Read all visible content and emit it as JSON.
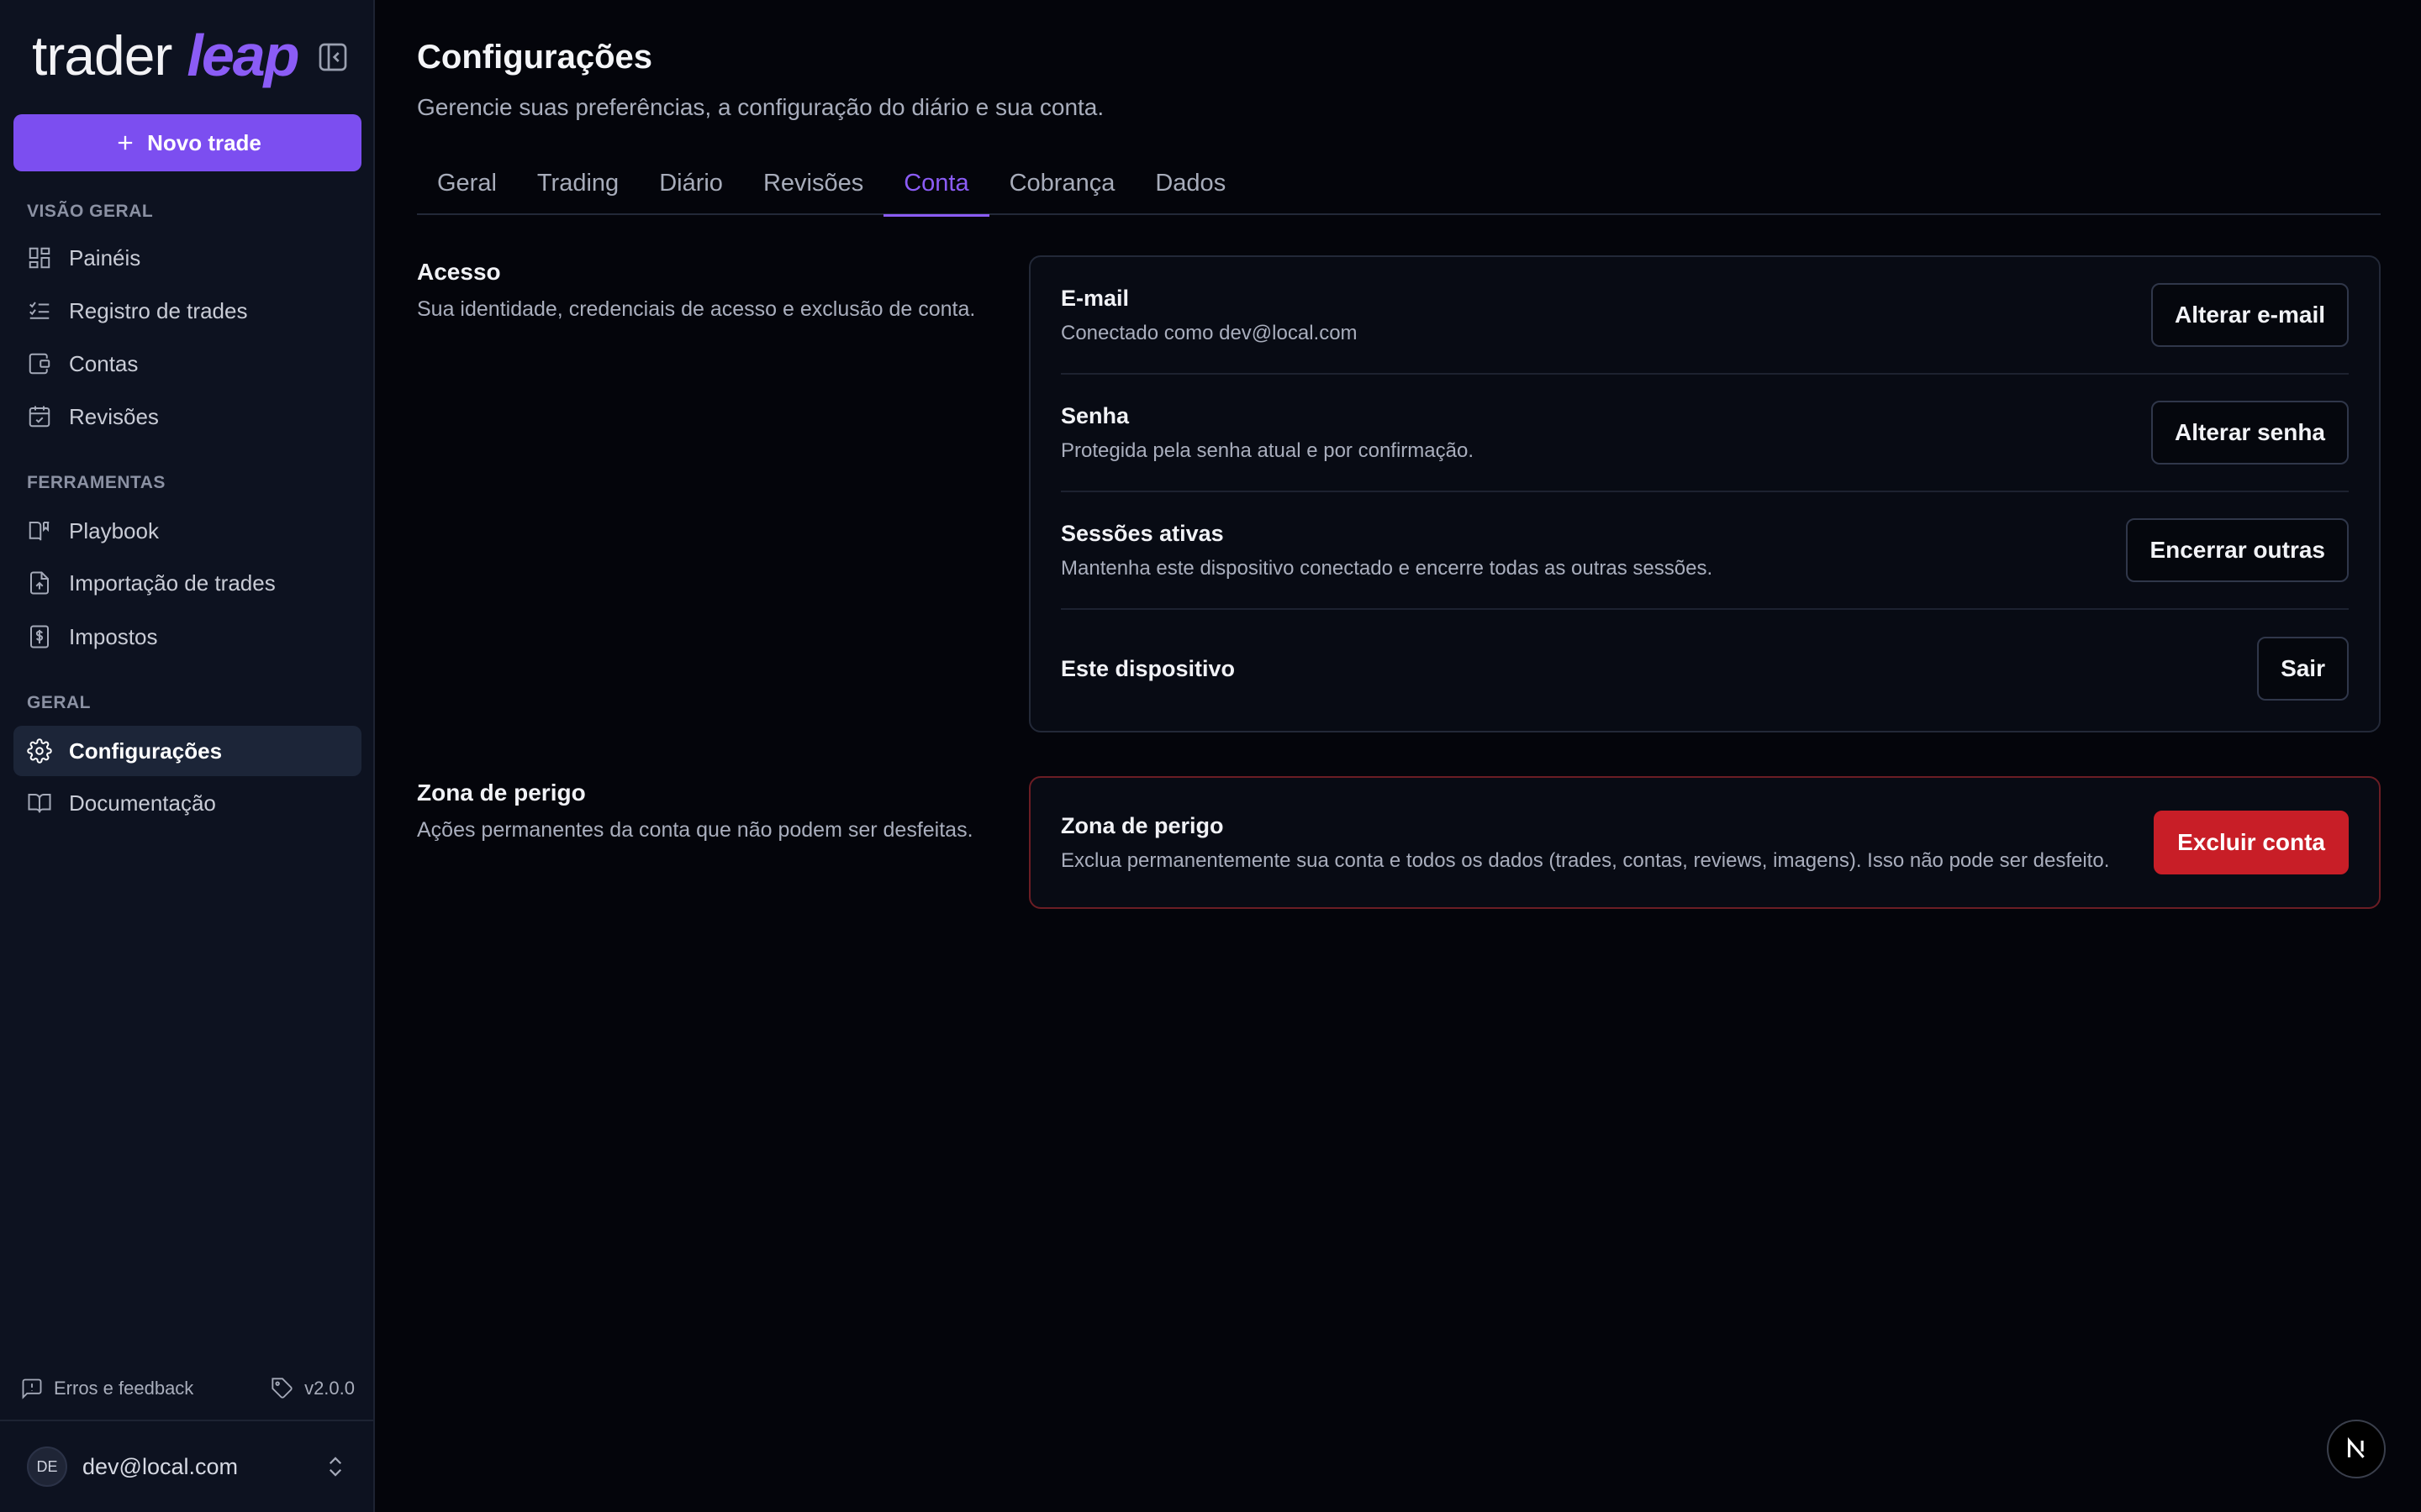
{
  "brand": {
    "part1": "trader",
    "part2": "leap"
  },
  "sidebar": {
    "new_trade_label": "Novo trade",
    "sections": [
      {
        "label": "VISÃO GERAL",
        "items": [
          {
            "label": "Painéis",
            "icon": "dashboard-icon"
          },
          {
            "label": "Registro de trades",
            "icon": "list-check-icon"
          },
          {
            "label": "Contas",
            "icon": "wallet-icon"
          },
          {
            "label": "Revisões",
            "icon": "calendar-check-icon"
          }
        ]
      },
      {
        "label": "FERRAMENTAS",
        "items": [
          {
            "label": "Playbook",
            "icon": "book-icon"
          },
          {
            "label": "Importação de trades",
            "icon": "file-upload-icon"
          },
          {
            "label": "Impostos",
            "icon": "tax-icon"
          }
        ]
      },
      {
        "label": "GERAL",
        "items": [
          {
            "label": "Configurações",
            "icon": "gear-icon",
            "active": true
          },
          {
            "label": "Documentação",
            "icon": "open-book-icon"
          }
        ]
      }
    ],
    "footer": {
      "feedback_label": "Erros e feedback",
      "version": "v2.0.0"
    },
    "user": {
      "initials": "DE",
      "email": "dev@local.com"
    }
  },
  "header": {
    "title": "Configurações",
    "subtitle": "Gerencie suas preferências, a configuração do diário e sua conta."
  },
  "tabs": [
    {
      "label": "Geral"
    },
    {
      "label": "Trading"
    },
    {
      "label": "Diário"
    },
    {
      "label": "Revisões"
    },
    {
      "label": "Conta",
      "active": true
    },
    {
      "label": "Cobrança"
    },
    {
      "label": "Dados"
    }
  ],
  "access": {
    "title": "Acesso",
    "description": "Sua identidade, credenciais de acesso e exclusão de conta.",
    "rows": [
      {
        "title": "E-mail",
        "description": "Conectado como dev@local.com",
        "button": "Alterar e-mail"
      },
      {
        "title": "Senha",
        "description": "Protegida pela senha atual e por confirmação.",
        "button": "Alterar senha"
      },
      {
        "title": "Sessões ativas",
        "description": "Mantenha este dispositivo conectado e encerre todas as outras sessões.",
        "button": "Encerrar outras"
      },
      {
        "title": "Este dispositivo",
        "description": "",
        "button": "Sair"
      }
    ]
  },
  "danger": {
    "title": "Zona de perigo",
    "description": "Ações permanentes da conta que não podem ser desfeitas.",
    "card_title": "Zona de perigo",
    "card_description": "Exclua permanentemente sua conta e todos os dados (trades, contas, reviews, imagens). Isso não pode ser desfeito.",
    "button": "Excluir conta",
    "accent_color": "#c81e27"
  },
  "colors": {
    "accent": "#7c4ef0",
    "tab_active": "#8b5cf6"
  },
  "dev_badge": "N"
}
